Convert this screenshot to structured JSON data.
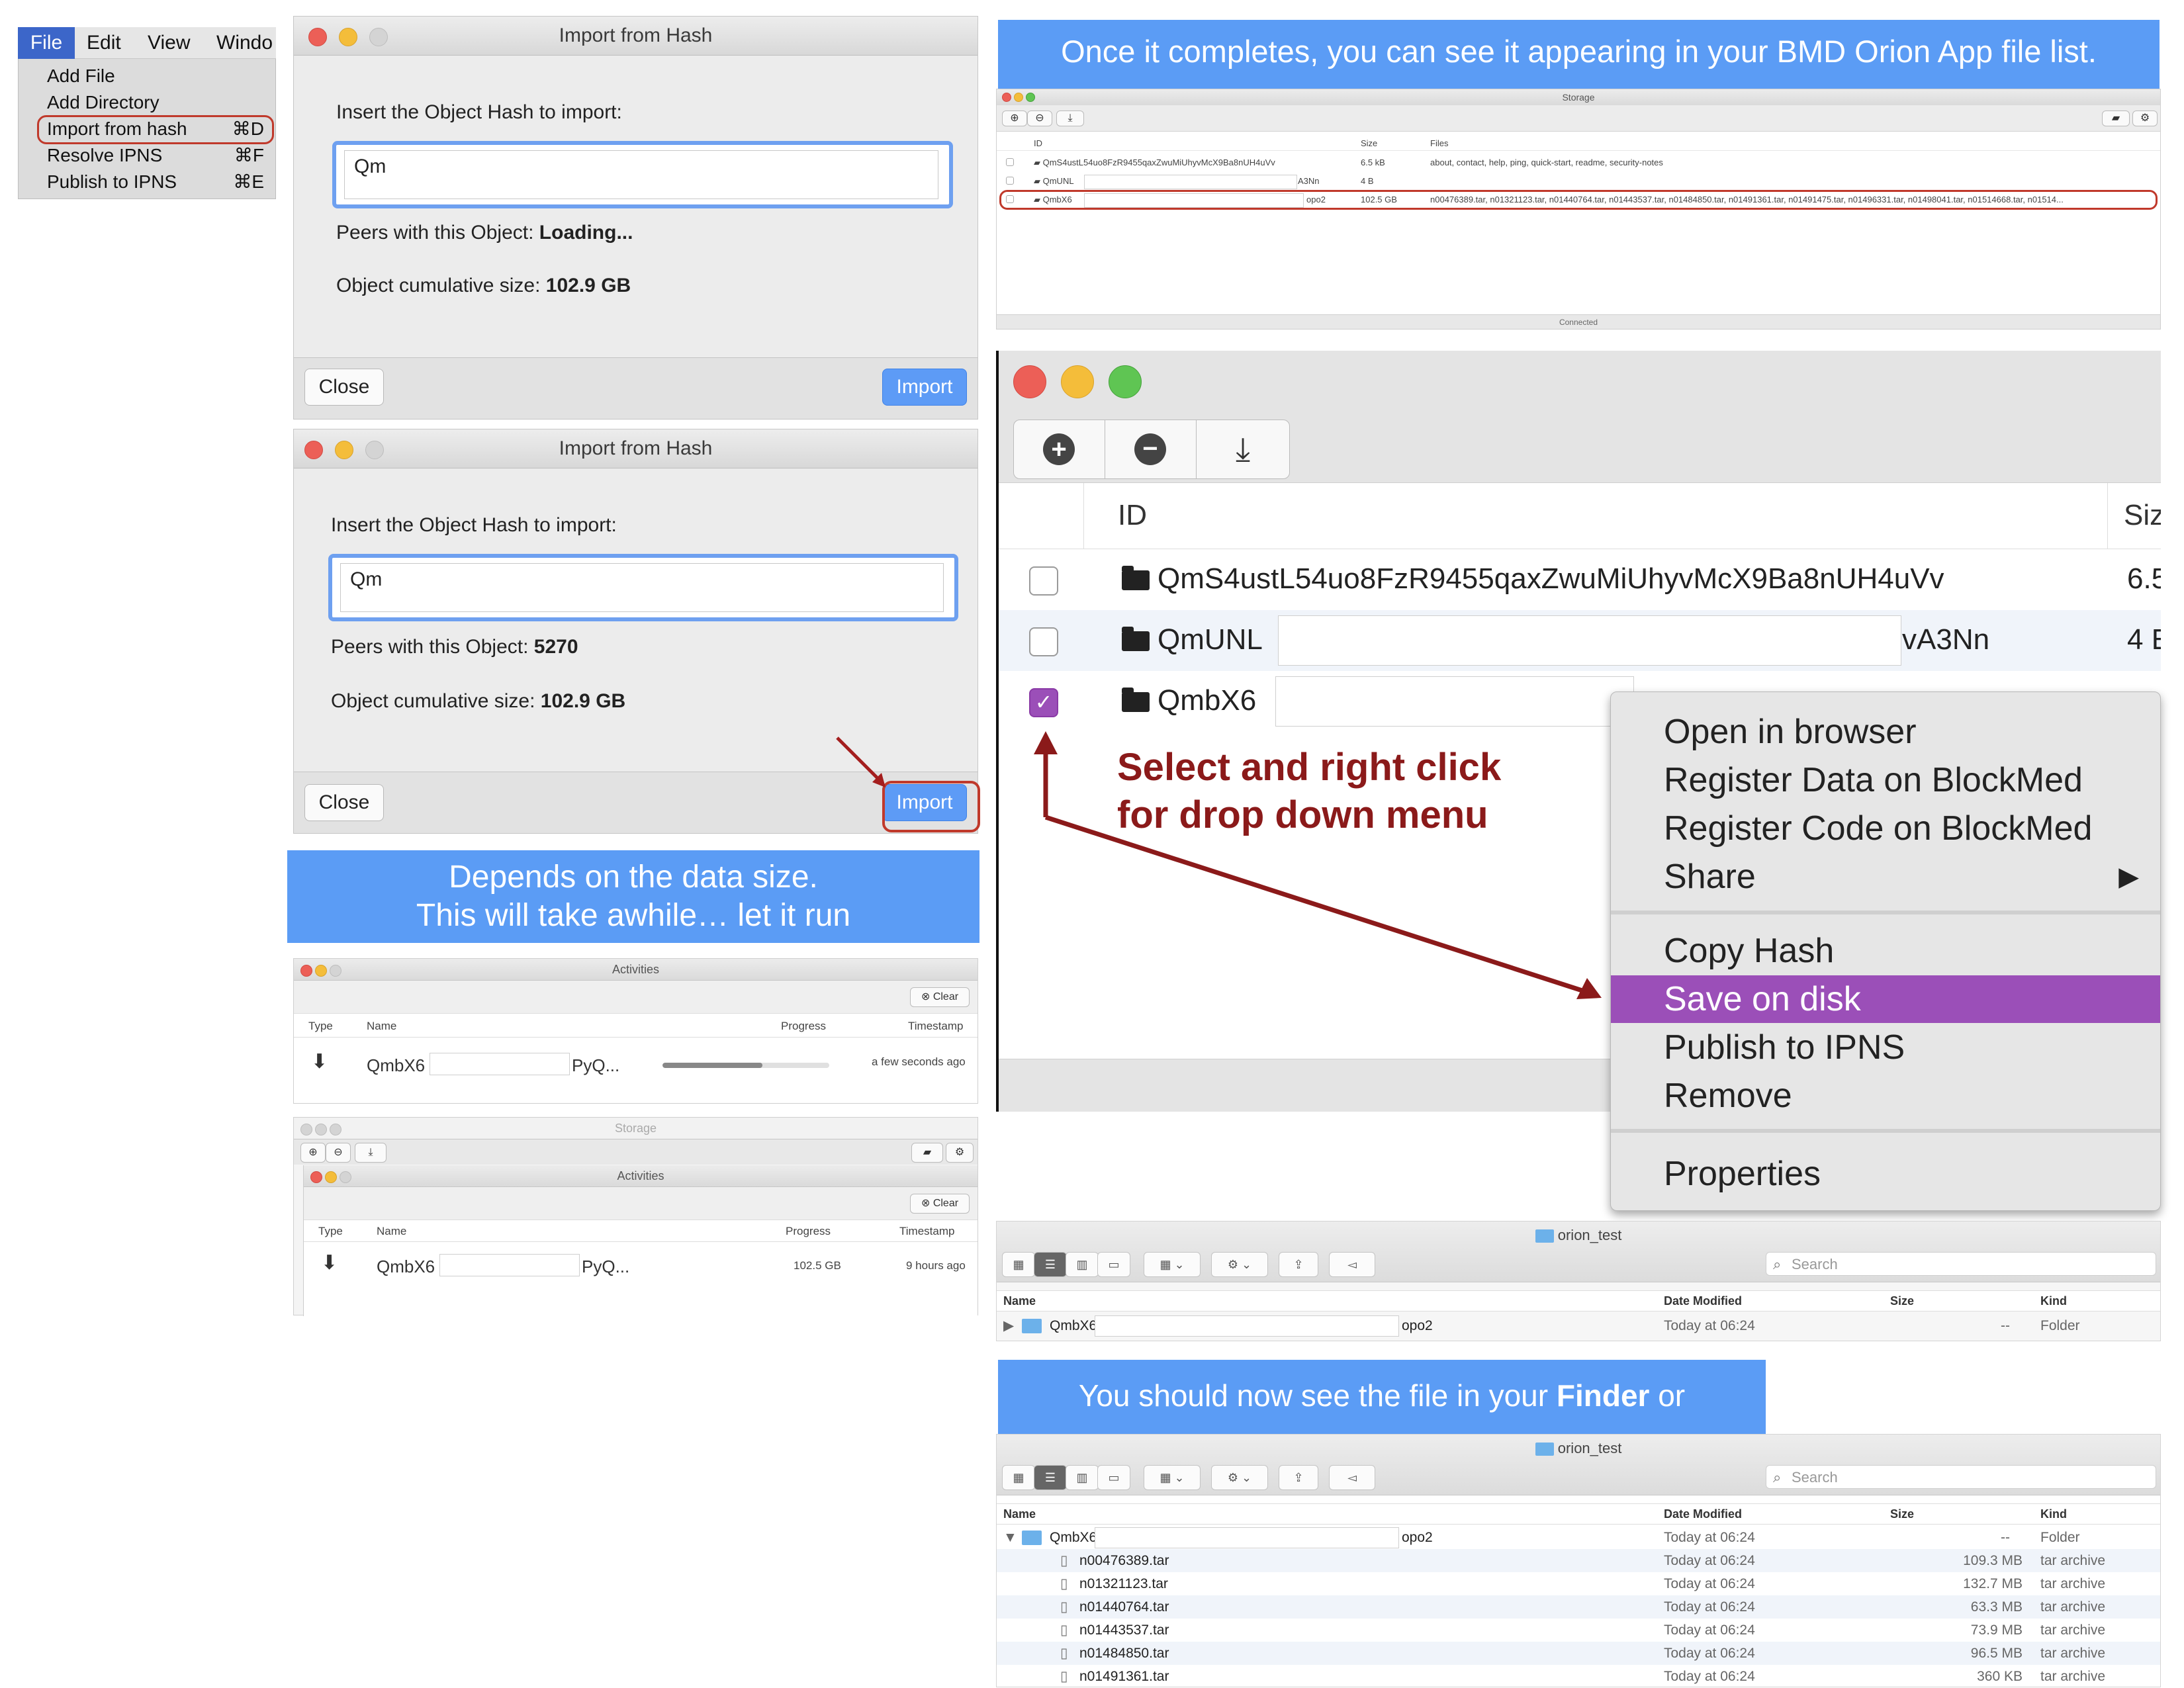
{
  "menu": {
    "bar": [
      "File",
      "Edit",
      "View",
      "Windo"
    ],
    "items": [
      {
        "label": "Add File",
        "shortcut": ""
      },
      {
        "label": "Add Directory",
        "shortcut": ""
      },
      {
        "label": "Import from hash",
        "shortcut": "⌘D"
      },
      {
        "label": "Resolve IPNS",
        "shortcut": "⌘F"
      },
      {
        "label": "Publish to IPNS",
        "shortcut": "⌘E"
      }
    ]
  },
  "dialog1": {
    "title": "Import from Hash",
    "prompt": "Insert the Object Hash to import:",
    "hash": "Qm",
    "peers_label": "Peers with this Object:",
    "peers_value": "Loading...",
    "size_label": "Object cumulative size:",
    "size_value": "102.9 GB",
    "close": "Close",
    "import": "Import"
  },
  "dialog2": {
    "title": "Import from Hash",
    "prompt": "Insert the Object Hash to import:",
    "hash": "Qm",
    "peers_label": "Peers with this Object:",
    "peers_value": "5270",
    "size_label": "Object cumulative size:",
    "size_value": "102.9 GB",
    "close": "Close",
    "import": "Import"
  },
  "banner_wait": {
    "line1": "Depends on the data size.",
    "line2": "This will take awhile… let it run"
  },
  "activities1": {
    "title": "Activities",
    "clear": "Clear",
    "cols": [
      "Type",
      "Name",
      "Progress",
      "Timestamp"
    ],
    "row": {
      "name_start": "QmbX6",
      "name_end": "PyQ...",
      "timestamp": "a few seconds ago",
      "progress": 0.6
    }
  },
  "activities2": {
    "storage_title": "Storage",
    "title": "Activities",
    "clear": "Clear",
    "cols": [
      "Type",
      "Name",
      "Progress",
      "Timestamp"
    ],
    "row": {
      "name_start": "QmbX6",
      "name_end": "PyQ...",
      "progress_text": "102.5 GB",
      "timestamp": "9 hours ago"
    }
  },
  "banner_done": "Once it completes, you can see it appearing in your BMD Orion App file list.",
  "storage_small": {
    "title": "Storage",
    "cols": [
      "ID",
      "Size",
      "Files"
    ],
    "rows": [
      {
        "id": "QmS4ustL54uo8FzR9455qaxZwuMiUhyvMcX9Ba8nUH4uVv",
        "size": "6.5 kB",
        "files": "about, contact, help, ping, quick-start, readme, security-notes"
      },
      {
        "id": "QmUNL",
        "id_end": "A3Nn",
        "size": "4 B",
        "files": ""
      },
      {
        "id": "QmbX6",
        "id_end": "opo2",
        "size": "102.5 GB",
        "files": "n00476389.tar, n01321123.tar, n01440764.tar, n01443537.tar, n01484850.tar, n01491361.tar, n01491475.tar, n01496331.tar, n01498041.tar, n01514668.tar, n01514..."
      }
    ],
    "status": "Connected"
  },
  "storage_big": {
    "col_id": "ID",
    "col_size": "Siz",
    "rows": [
      {
        "id": "QmS4ustL54uo8FzR9455qaxZwuMiUhyvMcX9Ba8nUH4uVv",
        "size": "6.5",
        "checked": false
      },
      {
        "id": "QmUNL",
        "id_end": "vA3Nn",
        "size": "4 E",
        "checked": false
      },
      {
        "id": "QmbX6",
        "id_end": "",
        "size": "",
        "checked": true
      }
    ]
  },
  "annotation": {
    "line1": "Select and right click",
    "line2": "for drop down menu"
  },
  "context_menu": {
    "group1": [
      "Open in browser",
      "Register Data on BlockMed",
      "Register Code on BlockMed",
      "Share"
    ],
    "group2": [
      "Copy Hash",
      "Save on disk",
      "Publish to IPNS",
      "Remove"
    ],
    "group3": [
      "Properties"
    ],
    "selected": "Save on disk",
    "submenu_arrow": "▶"
  },
  "finder1": {
    "folder": "orion_test",
    "search": "Search",
    "cols": [
      "Name",
      "Date Modified",
      "Size",
      "Kind"
    ],
    "rows": [
      {
        "name": "QmbX6",
        "name_end": "opo2",
        "date": "Today at 06:24",
        "size": "--",
        "kind": "Folder"
      }
    ]
  },
  "banner_finder": {
    "text_before": "You should now see the file in your ",
    "bold": "Finder",
    "text_after": " or"
  },
  "finder2": {
    "folder": "orion_test",
    "search": "Search",
    "cols": [
      "Name",
      "Date Modified",
      "Size",
      "Kind"
    ],
    "parent": {
      "name": "QmbX6",
      "name_end": "opo2",
      "date": "Today at 06:24",
      "size": "--",
      "kind": "Folder"
    },
    "rows": [
      {
        "name": "n00476389.tar",
        "date": "Today at 06:24",
        "size": "109.3 MB",
        "kind": "tar archive"
      },
      {
        "name": "n01321123.tar",
        "date": "Today at 06:24",
        "size": "132.7 MB",
        "kind": "tar archive"
      },
      {
        "name": "n01440764.tar",
        "date": "Today at 06:24",
        "size": "63.3 MB",
        "kind": "tar archive"
      },
      {
        "name": "n01443537.tar",
        "date": "Today at 06:24",
        "size": "73.9 MB",
        "kind": "tar archive"
      },
      {
        "name": "n01484850.tar",
        "date": "Today at 06:24",
        "size": "96.5 MB",
        "kind": "tar archive"
      },
      {
        "name": "n01491361.tar",
        "date": "Today at 06:24",
        "size": "360 KB",
        "kind": "tar archive"
      }
    ]
  },
  "colors": {
    "accent": "#5b9cf5",
    "selection": "#9b4fb8",
    "annotation": "#8b1a1a",
    "highlight": "#c0392b"
  }
}
